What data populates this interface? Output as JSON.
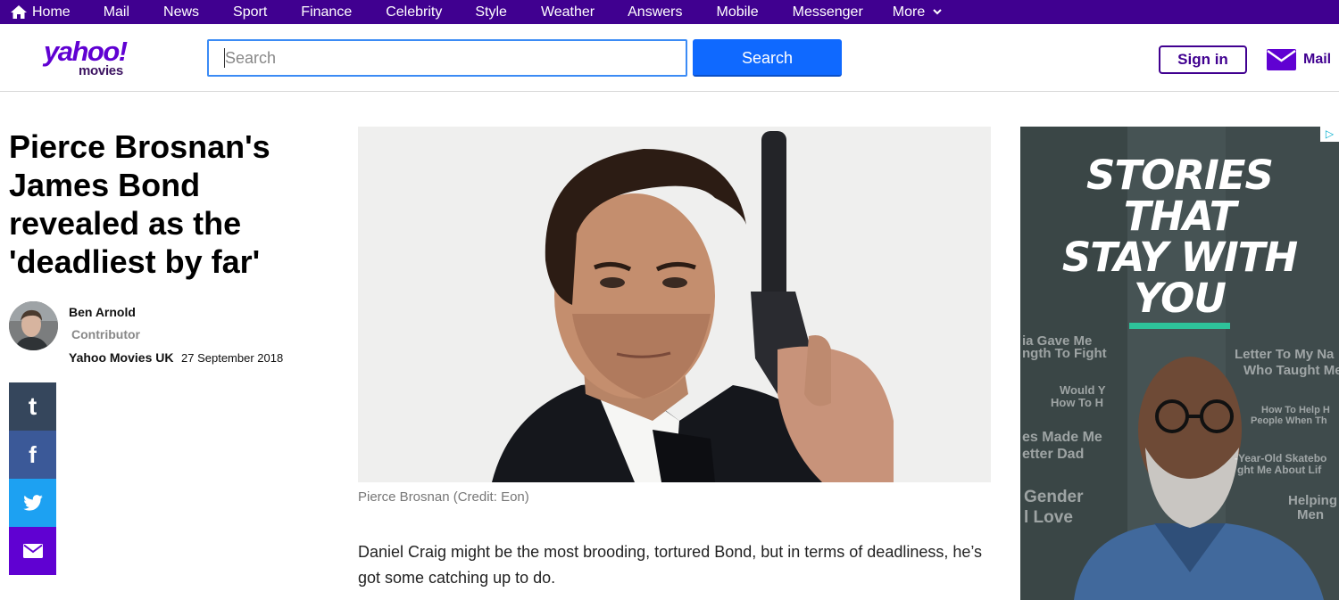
{
  "nav": {
    "home": "Home",
    "items": [
      "Mail",
      "News",
      "Sport",
      "Finance",
      "Celebrity",
      "Style",
      "Weather",
      "Answers",
      "Mobile",
      "Messenger"
    ],
    "more": "More"
  },
  "header": {
    "logo_main": "yahoo!",
    "logo_sub": "movies",
    "search_placeholder": "Search",
    "search_button": "Search",
    "signin": "Sign in",
    "mail": "Mail"
  },
  "article": {
    "headline": "Pierce Brosnan's James Bond revealed as the 'deadliest by far'",
    "author": "Ben Arnold",
    "role": "Contributor",
    "source": "Yahoo Movies UK",
    "date": "27 September 2018",
    "image_caption": "Pierce Brosnan (Credit: Eon)",
    "first_paragraph": "Daniel Craig might be the most brooding, tortured Bond, but in terms of deadliness, he’s got some catching up to do."
  },
  "share": {
    "tumblr_glyph": "t",
    "facebook_glyph": "f"
  },
  "ad": {
    "badge": "▷",
    "headline_lines": [
      "STORIES",
      "THAT",
      "STAY WITH",
      "YOU"
    ],
    "bg_texts": [
      "ia Gave Me",
      "ngth To Fight",
      "Would Y",
      "How To H",
      "es Made Me",
      "etter Dad",
      "Gender",
      "l Love",
      "Letter To My Na",
      "Who Taught Me",
      "How To Help H",
      "People When Th",
      "-Year-Old Skatebo",
      "ght Me About Lif",
      "Helping",
      "Men"
    ]
  },
  "colors": {
    "nav_bg": "#400090",
    "brand_purple": "#6001d2",
    "search_blue": "#0f69ff"
  }
}
